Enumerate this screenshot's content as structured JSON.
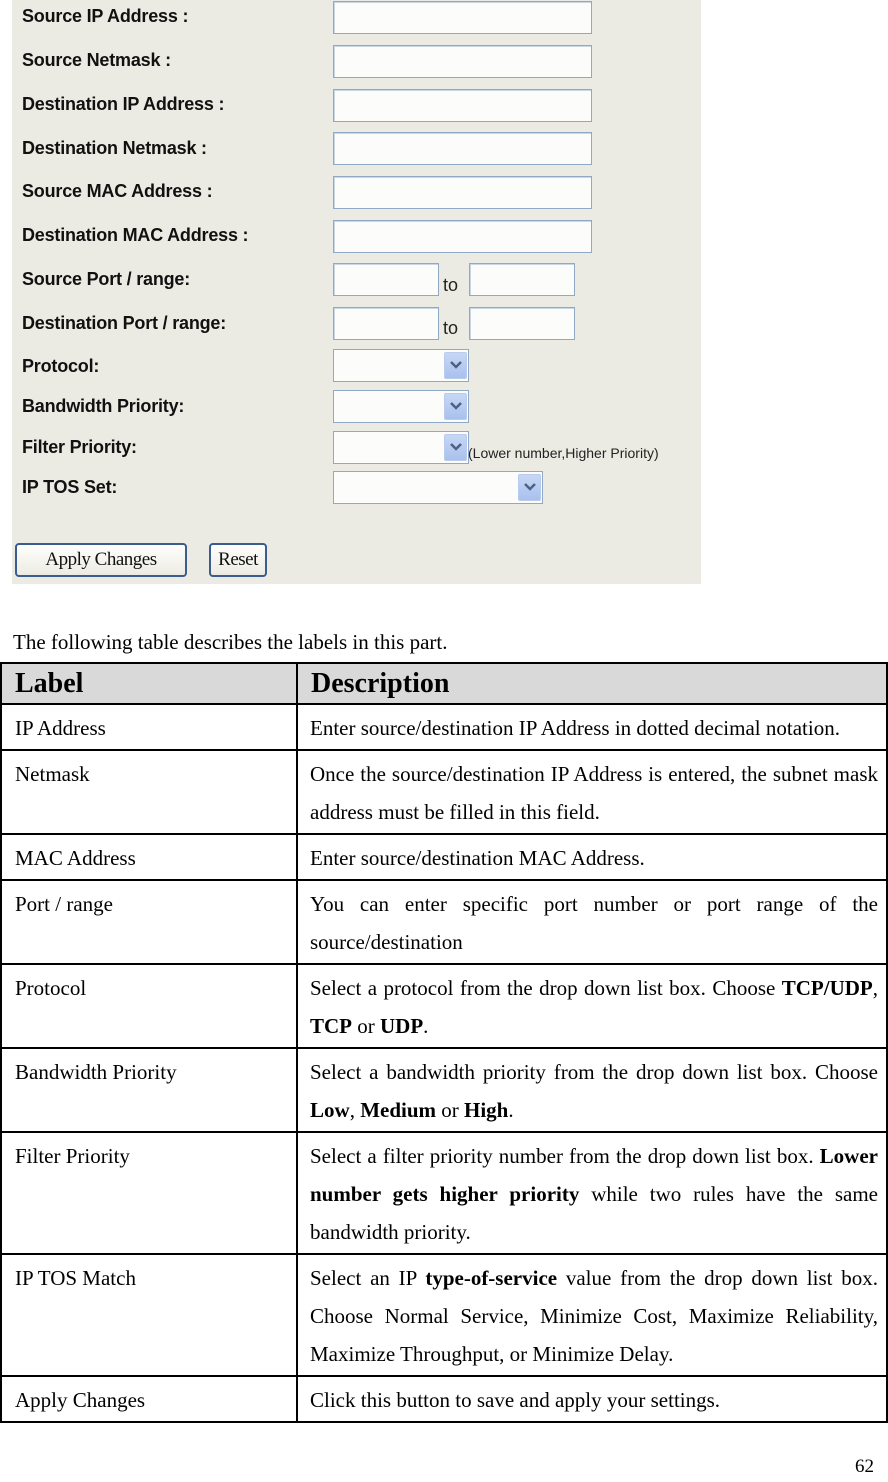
{
  "form": {
    "fields": [
      {
        "label": "Source IP Address :",
        "value": ""
      },
      {
        "label": "Source Netmask :",
        "value": ""
      },
      {
        "label": "Destination IP Address :",
        "value": ""
      },
      {
        "label": "Destination Netmask :",
        "value": ""
      },
      {
        "label": "Source MAC Address :",
        "value": ""
      },
      {
        "label": "Destination MAC Address :",
        "value": ""
      }
    ],
    "ranges": [
      {
        "label": "Source Port / range:",
        "from": "",
        "to_label": "to",
        "to": ""
      },
      {
        "label": "Destination Port / range:",
        "from": "",
        "to_label": "to",
        "to": ""
      }
    ],
    "selects": [
      {
        "label": "Protocol:",
        "selected": ""
      },
      {
        "label": "Bandwidth Priority:",
        "selected": ""
      },
      {
        "label": "Filter Priority:",
        "selected": "",
        "hint": "(Lower number,Higher Priority)"
      },
      {
        "label": "IP TOS Set:",
        "selected": ""
      }
    ],
    "buttons": {
      "apply": "Apply Changes",
      "reset": "Reset"
    }
  },
  "intro": "The following table describes the labels in this part.",
  "table": {
    "headers": [
      "Label",
      "Description"
    ],
    "rows": [
      {
        "label": "IP Address",
        "desc": [
          {
            "t": "Enter source/destination IP Address in  dotted decimal notation."
          }
        ]
      },
      {
        "label": "Netmask",
        "desc": [
          {
            "t": "Once the source/destination IP Address is entered, the subnet mask address must be filled in this field."
          }
        ]
      },
      {
        "label": "MAC Address",
        "desc": [
          {
            "t": "Enter source/destination MAC Address."
          }
        ]
      },
      {
        "label": "Port / range",
        "desc": [
          {
            "t": "You can enter specific port number or port range of the source/destination"
          }
        ]
      },
      {
        "label": "Protocol",
        "desc": [
          {
            "t": "Select a protocol from the drop down list box. Choose "
          },
          {
            "t": "TCP/UDP",
            "b": true
          },
          {
            "t": ", "
          },
          {
            "t": "TCP",
            "b": true
          },
          {
            "t": " or "
          },
          {
            "t": "UDP",
            "b": true
          },
          {
            "t": "."
          }
        ]
      },
      {
        "label": "Bandwidth Priority",
        "desc": [
          {
            "t": "Select a bandwidth priority from the drop down list box. Choose "
          },
          {
            "t": "Low",
            "b": true
          },
          {
            "t": ", "
          },
          {
            "t": "Medium",
            "b": true
          },
          {
            "t": " or "
          },
          {
            "t": "High",
            "b": true
          },
          {
            "t": "."
          }
        ]
      },
      {
        "label": "Filter Priority",
        "desc": [
          {
            "t": "Select a filter priority number from the drop down list box. "
          },
          {
            "t": "Lower number gets higher priority",
            "b": true
          },
          {
            "t": " while two rules have the same bandwidth priority."
          }
        ]
      },
      {
        "label": "IP TOS Match",
        "desc": [
          {
            "t": "Select an IP "
          },
          {
            "t": "type-of-service",
            "b": true
          },
          {
            "t": " value from the drop down list box. Choose Normal Service, Minimize Cost, Maximize Reliability, Maximize Throughput, or Minimize Delay."
          }
        ]
      },
      {
        "label": "Apply Changes",
        "desc": [
          {
            "t": "Click this button to save and apply your settings."
          }
        ]
      }
    ]
  },
  "page_number": "62"
}
